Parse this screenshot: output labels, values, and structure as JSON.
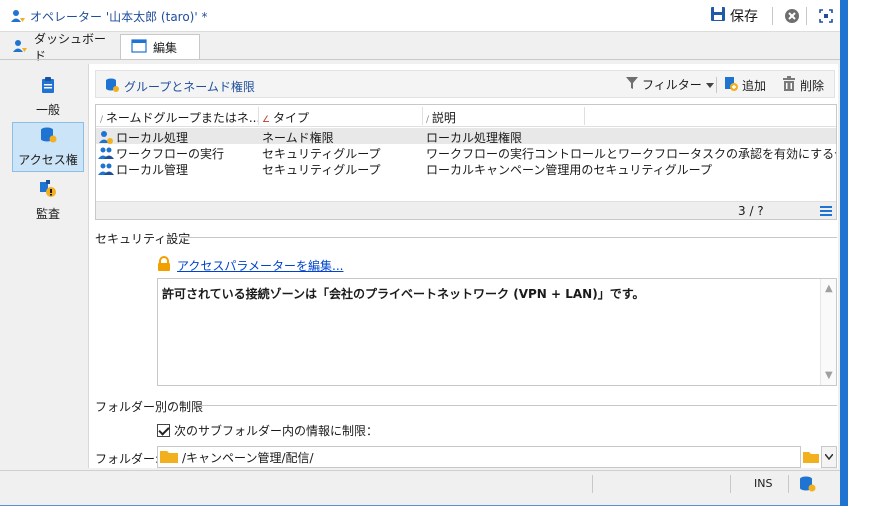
{
  "title": "オペレーター '山本太郎 (taro)' *",
  "titlebar": {
    "save_label": "保存"
  },
  "tabs": [
    {
      "label": "ダッシュボード"
    },
    {
      "label": "編集"
    }
  ],
  "nav": {
    "items": [
      {
        "label": "一般"
      },
      {
        "label": "アクセス権"
      },
      {
        "label": "監査"
      }
    ]
  },
  "toolbar": {
    "section_title": "グループとネームド権限",
    "filter_label": "フィルター",
    "add_label": "追加",
    "delete_label": "削除"
  },
  "grid": {
    "columns": [
      "ネームドグループまたはネ...",
      "タイプ",
      "説明"
    ],
    "rows": [
      {
        "name": "ローカル処理",
        "type": "ネームド権限",
        "description": "ローカル処理権限",
        "icon": "named-right-icon"
      },
      {
        "name": "ワークフローの実行",
        "type": "セキュリティグループ",
        "description": "ワークフローの実行コントロールとワークフロータスクの承認を有効にするセキュリテ..",
        "icon": "security-group-icon"
      },
      {
        "name": "ローカル管理",
        "type": "セキュリティグループ",
        "description": "ローカルキャンペーン管理用のセキュリティグループ",
        "icon": "security-group-icon"
      }
    ],
    "count": "3 / ?"
  },
  "security": {
    "section_label": "セキュリティ設定",
    "link_label": "アクセスパラメーターを編集...",
    "message": "許可されている接続ゾーンは「会社のプライベートネットワーク (VPN + LAN)」です。"
  },
  "folder_restriction": {
    "section_label": "フォルダー別の制限",
    "checkbox_label": "次のサブフォルダー内の情報に制限：",
    "checkbox_checked": true,
    "folder_label": "フォルダー:",
    "folder_value": "/キャンペーン管理/配信/"
  },
  "statusbar": {
    "mode": "INS"
  },
  "colors": {
    "accent": "#1f73d1",
    "link": "#0044cc",
    "selected_nav": "#cce4f7"
  }
}
